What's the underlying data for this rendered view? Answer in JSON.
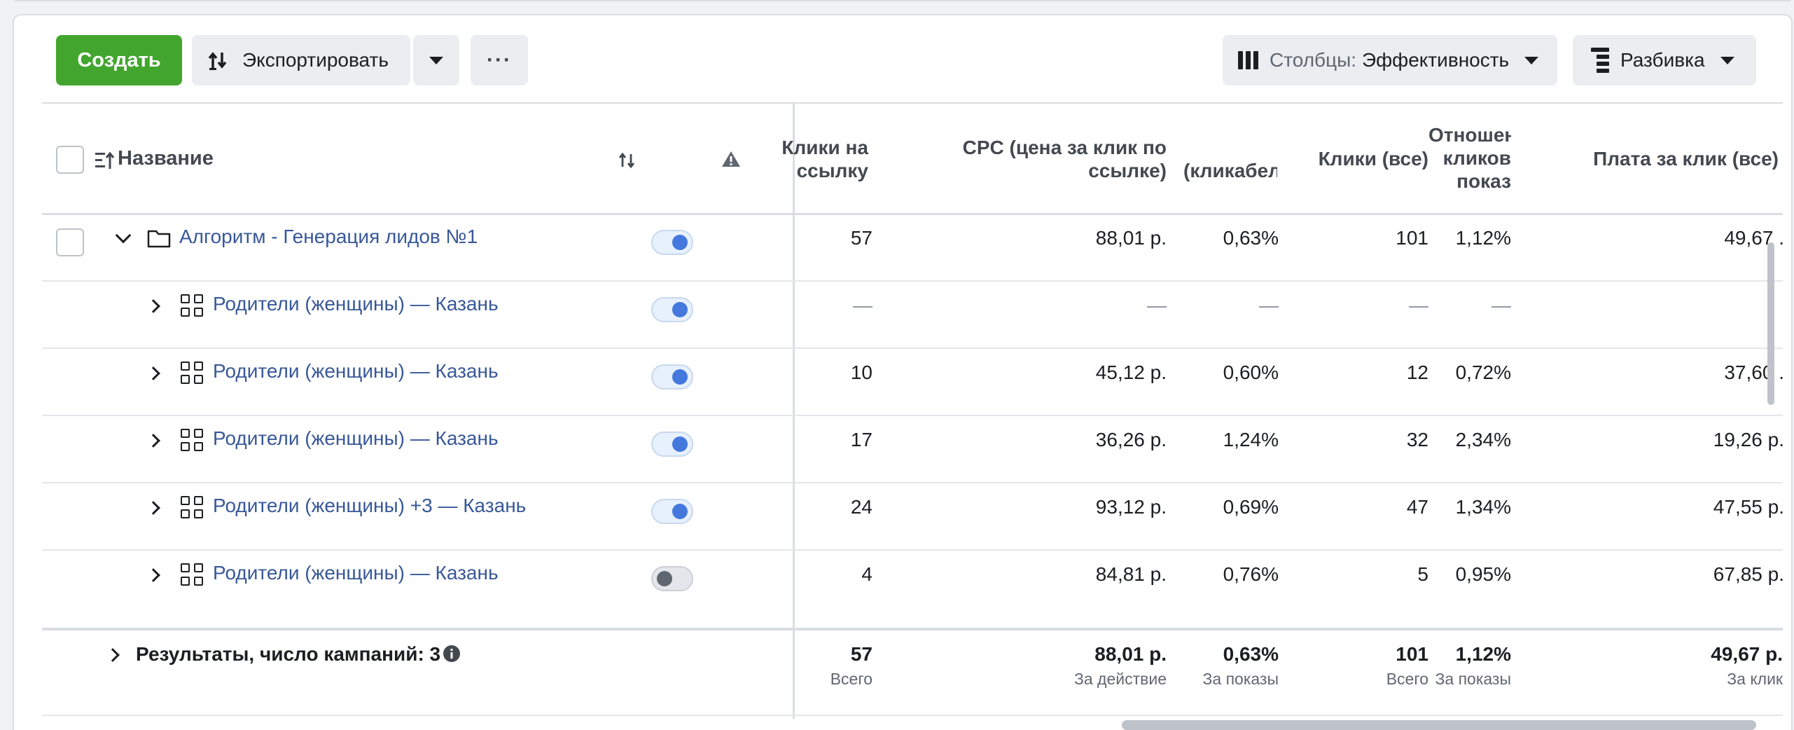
{
  "toolbar": {
    "create_label": "Создать",
    "export_label": "Экспортировать",
    "more_label": "···",
    "columns_prefix": "Столбцы:",
    "columns_value": "Эффективность",
    "breakdown_label": "Разбивка"
  },
  "table": {
    "headers": {
      "name": "Название",
      "link_clicks": [
        "Клики на",
        "ссылку"
      ],
      "cpc_link": [
        "CPC (цена за клик по",
        "ссылке)"
      ],
      "ctr": "(кликабел",
      "clicks_all": "Клики (все)",
      "ratio": [
        "Отношен",
        "кликов",
        "показ"
      ],
      "cpc_all": "Плата за клик (все)"
    },
    "rows": [
      {
        "name": "Алгоритм - Генерация лидов №1",
        "type": "campaign",
        "status": "on",
        "link_clicks": "57",
        "cpc_link": "88,01 р.",
        "ctr": "0,63%",
        "clicks_all": "101",
        "ratio": "1,12%",
        "cpc_all": "49,67 ."
      },
      {
        "name": "Родители (женщины) — Казань",
        "type": "adset",
        "status": "on",
        "link_clicks": "—",
        "cpc_link": "—",
        "ctr": "—",
        "clicks_all": "—",
        "ratio": "—",
        "cpc_all": ""
      },
      {
        "name": "Родители (женщины) — Казань",
        "type": "adset",
        "status": "on",
        "link_clicks": "10",
        "cpc_link": "45,12 р.",
        "ctr": "0,60%",
        "clicks_all": "12",
        "ratio": "0,72%",
        "cpc_all": "37,60 ."
      },
      {
        "name": "Родители (женщины) — Казань",
        "type": "adset",
        "status": "on",
        "link_clicks": "17",
        "cpc_link": "36,26 р.",
        "ctr": "1,24%",
        "clicks_all": "32",
        "ratio": "2,34%",
        "cpc_all": "19,26 р."
      },
      {
        "name": "Родители (женщины) +3 — Казань",
        "type": "adset",
        "status": "on",
        "link_clicks": "24",
        "cpc_link": "93,12 р.",
        "ctr": "0,69%",
        "clicks_all": "47",
        "ratio": "1,34%",
        "cpc_all": "47,55 р."
      },
      {
        "name": "Родители (женщины) — Казань",
        "type": "adset",
        "status": "off",
        "link_clicks": "4",
        "cpc_link": "84,81 р.",
        "ctr": "0,76%",
        "clicks_all": "5",
        "ratio": "0,95%",
        "cpc_all": "67,85 р."
      }
    ],
    "totals": {
      "label": "Результаты, число кампаний: 3",
      "link_clicks": "57",
      "link_clicks_sub": "Всего",
      "cpc_link": "88,01 р.",
      "cpc_link_sub": "За действие",
      "ctr": "0,63%",
      "ctr_sub": "За показы",
      "clicks_all": "101",
      "clicks_all_sub": "Всего",
      "ratio": "1,12%",
      "ratio_sub": "За показы",
      "cpc_all": "49,67 р.",
      "cpc_all_sub": "За клик"
    }
  },
  "colors": {
    "primary_green": "#42a62e",
    "link_blue": "#385898",
    "toggle_on": "#4478dd"
  },
  "icons": [
    "export-icon",
    "caret-down-icon",
    "more-icon",
    "columns-icon",
    "breakdown-icon",
    "sort-icon",
    "sort-arrows-icon",
    "warning-icon",
    "chevron-down-icon",
    "chevron-right-icon",
    "folder-icon",
    "adset-grid-icon",
    "info-icon"
  ]
}
